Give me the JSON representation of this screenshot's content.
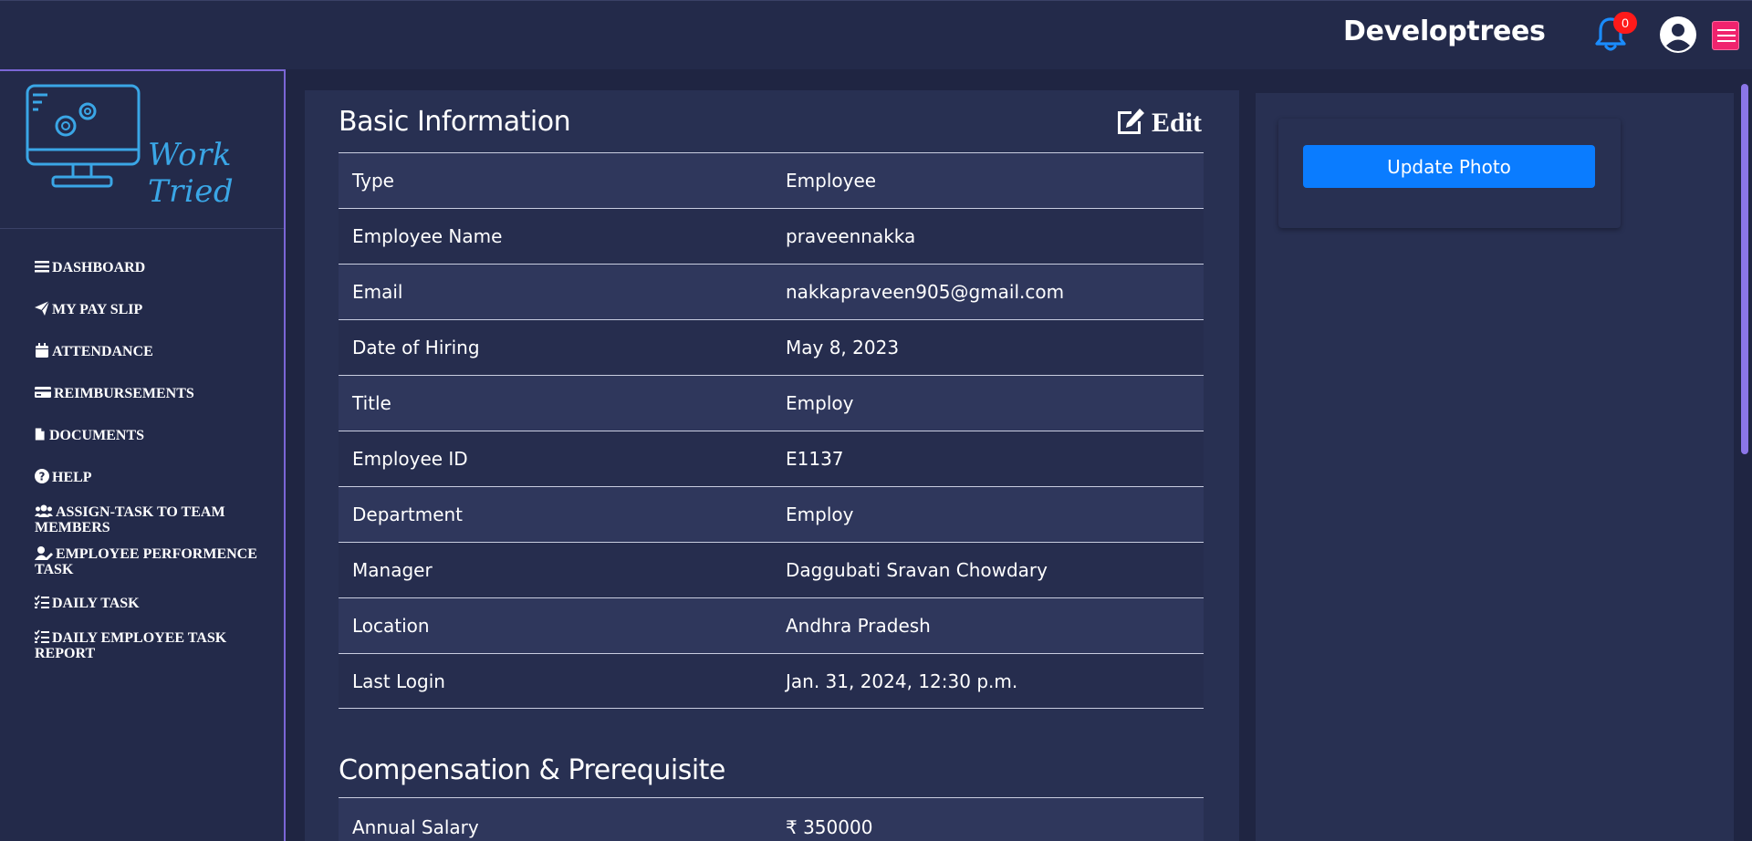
{
  "header": {
    "brand": "Developtrees",
    "notification_count": "0"
  },
  "sidebar": {
    "logo_text": "Work Tried",
    "items": [
      {
        "label": "DASHBOARD",
        "icon": "bars-icon"
      },
      {
        "label": "MY PAY SLIP",
        "icon": "paper-plane-icon"
      },
      {
        "label": "ATTENDANCE",
        "icon": "calendar-icon"
      },
      {
        "label": "REIMBURSEMENTS",
        "icon": "credit-card-icon"
      },
      {
        "label": "DOCUMENTS",
        "icon": "file-icon"
      },
      {
        "label": "HELP",
        "icon": "question-circle-icon"
      },
      {
        "label": "ASSIGN-TASK TO TEAM MEMBERS",
        "icon": "users-icon"
      },
      {
        "label": "EMPLOYEE PERFORMENCE TASK",
        "icon": "user-edit-icon"
      },
      {
        "label": "DAILY TASK",
        "icon": "list-check-icon"
      },
      {
        "label": "DAILY EMPLOYEE TASK REPORT",
        "icon": "list-check-icon"
      }
    ]
  },
  "basic_info": {
    "title": "Basic Information",
    "edit_label": "Edit",
    "rows": [
      {
        "key": "Type",
        "value": "Employee"
      },
      {
        "key": "Employee Name",
        "value": "praveennakka"
      },
      {
        "key": "Email",
        "value": "nakkapraveen905@gmail.com"
      },
      {
        "key": "Date of Hiring",
        "value": "May 8, 2023"
      },
      {
        "key": "Title",
        "value": "Employ"
      },
      {
        "key": "Employee ID",
        "value": "E1137"
      },
      {
        "key": "Department",
        "value": "Employ"
      },
      {
        "key": "Manager",
        "value": "Daggubati Sravan Chowdary"
      },
      {
        "key": "Location",
        "value": "Andhra Pradesh"
      },
      {
        "key": "Last Login",
        "value": "Jan. 31, 2024, 12:30 p.m."
      }
    ]
  },
  "compensation": {
    "title": "Compensation & Prerequisite",
    "rows": [
      {
        "key": "Annual Salary",
        "value": "₹  350000"
      }
    ]
  },
  "photo": {
    "button_label": "Update Photo"
  },
  "colors": {
    "accent_button": "#0a7cff",
    "menu_button": "#f0236e",
    "sidebar_border": "#7b66d6",
    "logo": "#3aa6e6",
    "badge": "#ff1a1a"
  }
}
